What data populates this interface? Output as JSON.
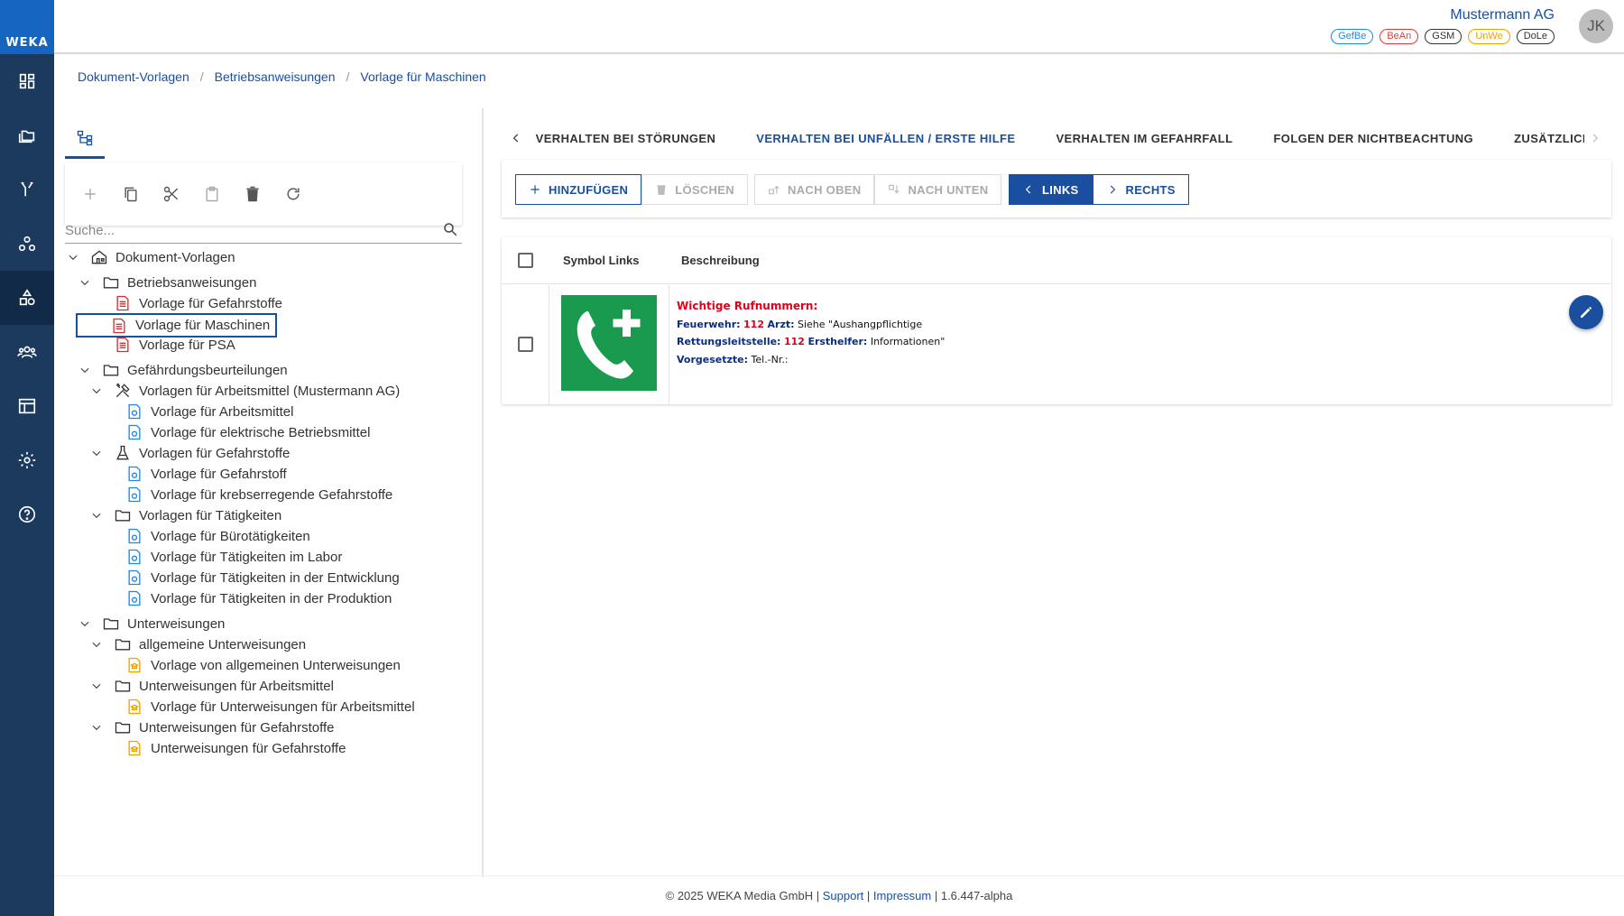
{
  "app": {
    "logo_text": "WEKA"
  },
  "sidebar": {
    "items": [
      {
        "icon": "dashboard-icon"
      },
      {
        "icon": "folders-icon"
      },
      {
        "icon": "fork-icon"
      },
      {
        "icon": "nodes-icon"
      },
      {
        "icon": "shapes-icon",
        "active": true
      },
      {
        "icon": "group-icon"
      },
      {
        "icon": "table-layout-icon"
      },
      {
        "icon": "gear-icon"
      },
      {
        "icon": "help-icon"
      }
    ]
  },
  "header": {
    "company": "Mustermann AG",
    "avatar_initials": "JK",
    "badges": [
      {
        "label": "GefBe",
        "color": "#1e88e5"
      },
      {
        "label": "BeAn",
        "color": "#e53935"
      },
      {
        "label": "GSM",
        "color": "#333333"
      },
      {
        "label": "UnWe",
        "color": "#f0a000"
      },
      {
        "label": "DoLe",
        "color": "#333333"
      }
    ]
  },
  "breadcrumb": [
    "Dokument-Vorlagen",
    "Betriebsanweisungen",
    "Vorlage für Maschinen"
  ],
  "tree": {
    "search_placeholder": "Suche...",
    "nodes": [
      {
        "label": "Dokument-Vorlagen",
        "level": 0,
        "icon": "home-icon",
        "expanded": true
      },
      {
        "label": "Betriebsanweisungen",
        "level": 1,
        "icon": "folder-icon",
        "expanded": true
      },
      {
        "label": "Vorlage für Gefahrstoffe",
        "level": 2,
        "icon": "doc-red-icon"
      },
      {
        "label": "Vorlage für Maschinen",
        "level": 2,
        "icon": "doc-red-icon",
        "selected": true
      },
      {
        "label": "Vorlage für PSA",
        "level": 2,
        "icon": "doc-red-icon"
      },
      {
        "label": "Gefährdungsbeurteilungen",
        "level": 1,
        "icon": "folder-icon",
        "expanded": true
      },
      {
        "label": "Vorlagen für Arbeitsmittel (Mustermann AG)",
        "level": 2,
        "icon": "tools-icon",
        "expanded": true
      },
      {
        "label": "Vorlage für Arbeitsmittel",
        "level": 3,
        "icon": "doc-blue-icon"
      },
      {
        "label": "Vorlage für elektrische Betriebsmittel",
        "level": 3,
        "icon": "doc-blue-icon"
      },
      {
        "label": "Vorlagen für Gefahrstoffe",
        "level": 2,
        "icon": "flask-icon",
        "expanded": true
      },
      {
        "label": "Vorlage für Gefahrstoff",
        "level": 3,
        "icon": "doc-blue-icon"
      },
      {
        "label": "Vorlage für krebserregende Gefahrstoffe",
        "level": 3,
        "icon": "doc-blue-icon"
      },
      {
        "label": "Vorlagen für Tätigkeiten",
        "level": 2,
        "icon": "folder-icon",
        "expanded": true
      },
      {
        "label": "Vorlage für Bürotätigkeiten",
        "level": 3,
        "icon": "doc-blue-icon"
      },
      {
        "label": "Vorlage für Tätigkeiten im Labor",
        "level": 3,
        "icon": "doc-blue-icon"
      },
      {
        "label": "Vorlage für Tätigkeiten in der Entwicklung",
        "level": 3,
        "icon": "doc-blue-icon"
      },
      {
        "label": "Vorlage für Tätigkeiten in der Produktion",
        "level": 3,
        "icon": "doc-blue-icon"
      },
      {
        "label": "Unterweisungen",
        "level": 1,
        "icon": "folder-icon",
        "expanded": true
      },
      {
        "label": "allgemeine Unterweisungen",
        "level": 2,
        "icon": "folder-icon",
        "expanded": true
      },
      {
        "label": "Vorlage von allgemeinen Unterweisungen",
        "level": 3,
        "icon": "doc-orange-icon"
      },
      {
        "label": "Unterweisungen für Arbeitsmittel",
        "level": 2,
        "icon": "folder-icon",
        "expanded": true
      },
      {
        "label": "Vorlage für Unterweisungen für Arbeitsmittel",
        "level": 3,
        "icon": "doc-orange-icon"
      },
      {
        "label": "Unterweisungen für Gefahrstoffe",
        "level": 2,
        "icon": "folder-icon",
        "expanded": true
      },
      {
        "label": "Unterweisungen für Gefahrstoffe",
        "level": 3,
        "icon": "doc-orange-icon"
      }
    ]
  },
  "tabs": [
    {
      "label": "VERHALTEN BEI STÖRUNGEN"
    },
    {
      "label": "VERHALTEN BEI UNFÄLLEN / ERSTE HILFE",
      "active": true
    },
    {
      "label": "VERHALTEN IM GEFAHRFALL"
    },
    {
      "label": "FOLGEN DER NICHTBEACHTUNG"
    },
    {
      "label": "ZUSÄTZLICH BEACHTEN"
    }
  ],
  "actions": {
    "add": "HINZUFÜGEN",
    "delete": "LÖSCHEN",
    "up": "NACH OBEN",
    "down": "NACH UNTEN",
    "left": "LINKS",
    "right": "RECHTS"
  },
  "table": {
    "columns": [
      "Symbol Links",
      "Beschreibung"
    ],
    "rows": [
      {
        "symbol": "first-aid-phone-icon",
        "title": "Wichtige Rufnummern:",
        "line1_label": "Feuerwehr:",
        "line1_num": "112",
        "line1_label2": "Arzt:",
        "line1_text": "Siehe \"Aushangpflichtige",
        "line2_label": "Rettungsleitstelle:",
        "line2_num": "112",
        "line2_label2": "Ersthelfer:",
        "line2_text": "Informationen\"",
        "line3_label": "Vorgesetzte:",
        "line3_text": "Tel.-Nr.:"
      }
    ]
  },
  "footer": {
    "copyright": "© 2025 WEKA Media GmbH |",
    "support": "Support",
    "sep": "|",
    "impressum": "Impressum",
    "version": "| 1.6.447-alpha"
  },
  "colors": {
    "sidebar": "#1b3a5e",
    "accent": "#1a4fa0",
    "logo_bg": "#1565c0",
    "first_aid_green": "#1a9a4f"
  }
}
